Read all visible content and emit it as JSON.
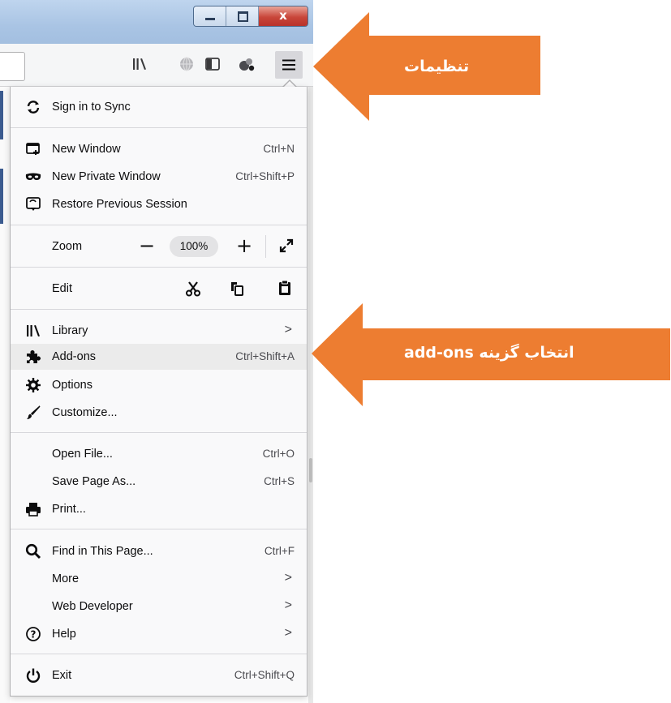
{
  "window": {
    "controls": [
      "minimize",
      "maximize",
      "close"
    ],
    "close_glyph": "x"
  },
  "toolbar": {
    "icons": [
      "library-icon",
      "globe-icon",
      "sidebar-icon",
      "extension-icon",
      "hamburger-menu-icon"
    ]
  },
  "menu": {
    "sign_in": "Sign in to Sync",
    "new_window": {
      "label": "New Window",
      "shortcut": "Ctrl+N"
    },
    "new_private_window": {
      "label": "New Private Window",
      "shortcut": "Ctrl+Shift+P"
    },
    "restore_session": {
      "label": "Restore Previous Session"
    },
    "zoom": {
      "label": "Zoom",
      "minus": "−",
      "value": "100%",
      "plus": "+"
    },
    "edit": {
      "label": "Edit"
    },
    "library": {
      "label": "Library",
      "chevron": ">"
    },
    "addons": {
      "label": "Add-ons",
      "shortcut": "Ctrl+Shift+A"
    },
    "options": {
      "label": "Options"
    },
    "customize": {
      "label": "Customize..."
    },
    "open_file": {
      "label": "Open File...",
      "shortcut": "Ctrl+O"
    },
    "save_page": {
      "label": "Save Page As...",
      "shortcut": "Ctrl+S"
    },
    "print": {
      "label": "Print..."
    },
    "find": {
      "label": "Find in This Page...",
      "shortcut": "Ctrl+F"
    },
    "more": {
      "label": "More",
      "chevron": ">"
    },
    "web_developer": {
      "label": "Web Developer",
      "chevron": ">"
    },
    "help": {
      "label": "Help",
      "chevron": ">"
    },
    "exit": {
      "label": "Exit",
      "shortcut": "Ctrl+Shift+Q"
    }
  },
  "annotations": {
    "settings": "تنظیمات",
    "select_addons": "انتخاب گزینه add-ons"
  },
  "colors": {
    "callout": "#ed7d31",
    "hover": "#ebebeb"
  }
}
